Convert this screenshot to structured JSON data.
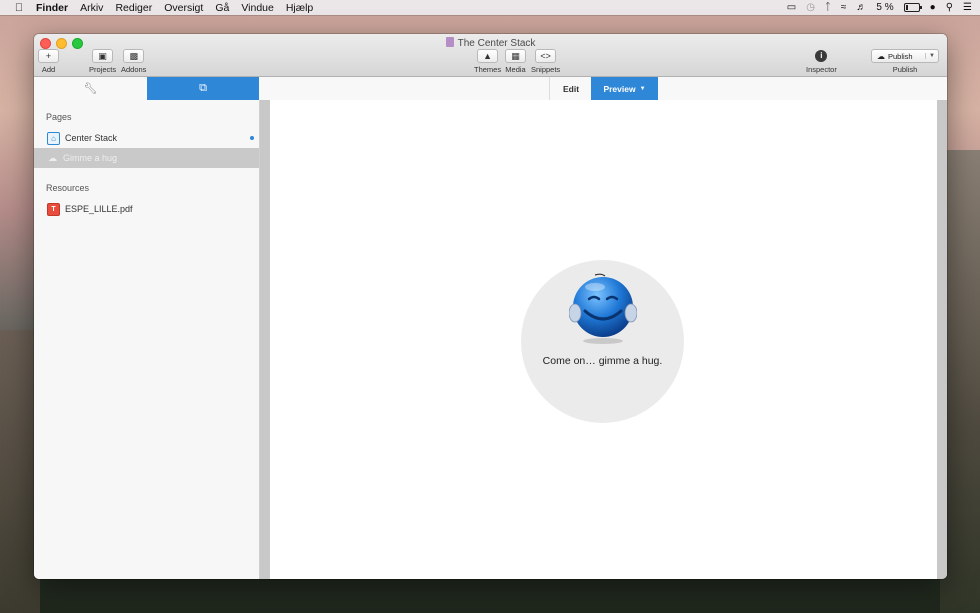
{
  "menubar": {
    "app_name": "Finder",
    "menus": [
      "Arkiv",
      "Rediger",
      "Oversigt",
      "Gå",
      "Vindue",
      "Hjælp"
    ],
    "battery_percent": "5 %"
  },
  "window": {
    "title": "The Center Stack",
    "toolbar": {
      "add_label": "Add",
      "projects_label": "Projects",
      "addons_label": "Addons",
      "themes_label": "Themes",
      "media_label": "Media",
      "snippets_label": "Snippets",
      "inspector_label": "Inspector",
      "publish_button_label": "Publish",
      "publish_label": "Publish"
    },
    "mode_tabs": {
      "edit_label": "Edit",
      "preview_label": "Preview"
    }
  },
  "sidebar": {
    "pages_heading": "Pages",
    "pages": [
      {
        "label": "Center Stack",
        "icon": "home-icon"
      },
      {
        "label": "Gimme a hug",
        "icon": "cloud-icon",
        "selected": true
      }
    ],
    "resources_heading": "Resources",
    "resources": [
      {
        "label": "ESPE_LILLE.pdf",
        "icon": "pdf-icon"
      }
    ]
  },
  "preview": {
    "caption": "Come on… gimme a hug."
  },
  "colors": {
    "accent": "#2f87d8",
    "selected_row": "#c9c9c9",
    "circle_bg": "#ebebeb"
  }
}
